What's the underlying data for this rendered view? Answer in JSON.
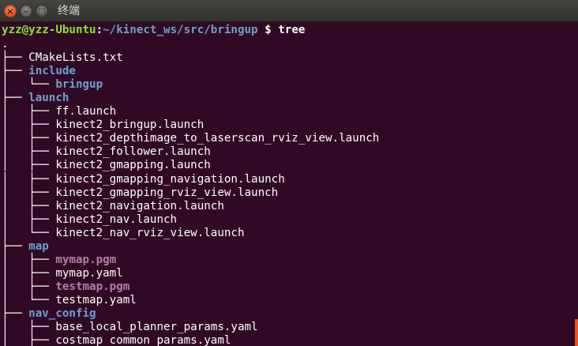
{
  "window": {
    "title": "终端",
    "close_glyph": "×",
    "min_glyph": "–",
    "max_glyph": "□"
  },
  "prompt": {
    "user_host": "yzz@yzz-Ubuntu",
    "separator": ":",
    "path": "~/kinect_ws/src/bringup",
    "sign": " $ ",
    "command": "tree"
  },
  "tree": [
    {
      "prefix": "",
      "name": ".",
      "kind": "file"
    },
    {
      "prefix": "├── ",
      "name": "CMakeLists.txt",
      "kind": "file"
    },
    {
      "prefix": "├── ",
      "name": "include",
      "kind": "dir"
    },
    {
      "prefix": "│   └── ",
      "name": "bringup",
      "kind": "dir"
    },
    {
      "prefix": "├── ",
      "name": "launch",
      "kind": "dir"
    },
    {
      "prefix": "│   ├── ",
      "name": "ff.launch",
      "kind": "file"
    },
    {
      "prefix": "│   ├── ",
      "name": "kinect2_bringup.launch",
      "kind": "file"
    },
    {
      "prefix": "│   ├── ",
      "name": "kinect2_depthimage_to_laserscan_rviz_view.launch",
      "kind": "file"
    },
    {
      "prefix": "│   ├── ",
      "name": "kinect2_follower.launch",
      "kind": "file"
    },
    {
      "prefix": "│   ├── ",
      "name": "kinect2_gmapping.launch",
      "kind": "file"
    },
    {
      "prefix": "│   ├── ",
      "name": "kinect2_gmapping_navigation.launch",
      "kind": "file"
    },
    {
      "prefix": "│   ├── ",
      "name": "kinect2_gmapping_rviz_view.launch",
      "kind": "file"
    },
    {
      "prefix": "│   ├── ",
      "name": "kinect2_navigation.launch",
      "kind": "file"
    },
    {
      "prefix": "│   ├── ",
      "name": "kinect2_nav.launch",
      "kind": "file"
    },
    {
      "prefix": "│   └── ",
      "name": "kinect2_nav_rviz_view.launch",
      "kind": "file"
    },
    {
      "prefix": "├── ",
      "name": "map",
      "kind": "dir"
    },
    {
      "prefix": "│   ├── ",
      "name": "mymap.pgm",
      "kind": "img"
    },
    {
      "prefix": "│   ├── ",
      "name": "mymap.yaml",
      "kind": "file"
    },
    {
      "prefix": "│   ├── ",
      "name": "testmap.pgm",
      "kind": "img"
    },
    {
      "prefix": "│   └── ",
      "name": "testmap.yaml",
      "kind": "file"
    },
    {
      "prefix": "├── ",
      "name": "nav_config",
      "kind": "dir"
    },
    {
      "prefix": "│   ├── ",
      "name": "base_local_planner_params.yaml",
      "kind": "file"
    },
    {
      "prefix": "│   ├── ",
      "name": "costmap_common_params.yaml",
      "kind": "file"
    }
  ],
  "colors": {
    "background": "#300a24",
    "user_host": "#8ae234",
    "path": "#729fcf",
    "directory": "#729fcf",
    "image_file": "#ad7fa8",
    "scrollbar": "#e95420"
  }
}
